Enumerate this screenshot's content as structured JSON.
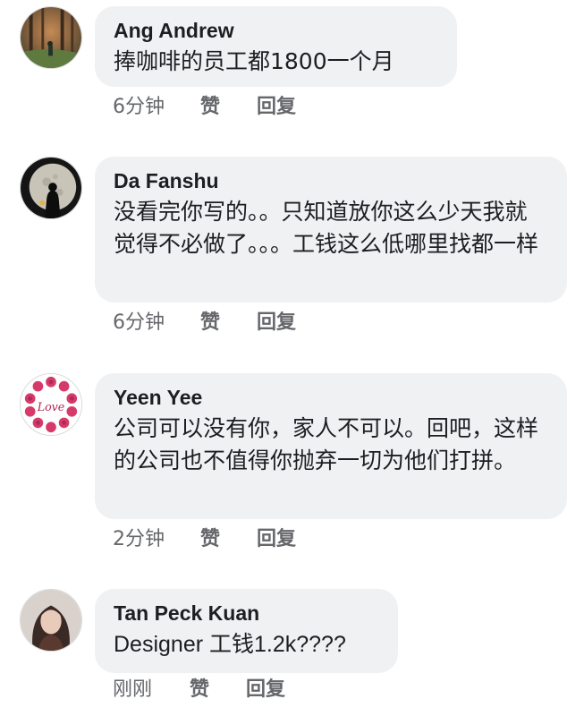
{
  "comments": [
    {
      "name": "Ang Andrew",
      "text": "捧咖啡的员工都1800一个月",
      "time": "6分钟",
      "like_label": "赞",
      "reply_label": "回复"
    },
    {
      "name": "Da Fanshu",
      "text": "没看完你写的。。只知道放你这么少天我就觉得不必做了。。。工钱这么低哪里找都一样",
      "time": "6分钟",
      "like_label": "赞",
      "reply_label": "回复"
    },
    {
      "name": "Yeen Yee",
      "text": "公司可以没有你，家人不可以。回吧，这样的公司也不值得你抛弃一切为他们打拼。",
      "time": "2分钟",
      "like_label": "赞",
      "reply_label": "回复"
    },
    {
      "name": "Tan Peck Kuan",
      "text": "Designer 工钱1.2k????",
      "time": "刚刚",
      "like_label": "赞",
      "reply_label": "回复"
    }
  ],
  "avatars": [
    {
      "icon": "forest-photo-avatar",
      "colors": [
        "#6f5a3f",
        "#9c6b4a",
        "#2f3b2a"
      ]
    },
    {
      "icon": "moon-silhouette-avatar",
      "colors": [
        "#1b1b1b",
        "#c9c4b8",
        "#e0b34a"
      ]
    },
    {
      "icon": "love-rose-avatar",
      "colors": [
        "#ffffff",
        "#d63a6a",
        "#b02a55"
      ],
      "logo_text": "Love"
    },
    {
      "icon": "portrait-photo-avatar",
      "colors": [
        "#3a2a25",
        "#e8cbb8",
        "#5a3a30"
      ]
    }
  ]
}
